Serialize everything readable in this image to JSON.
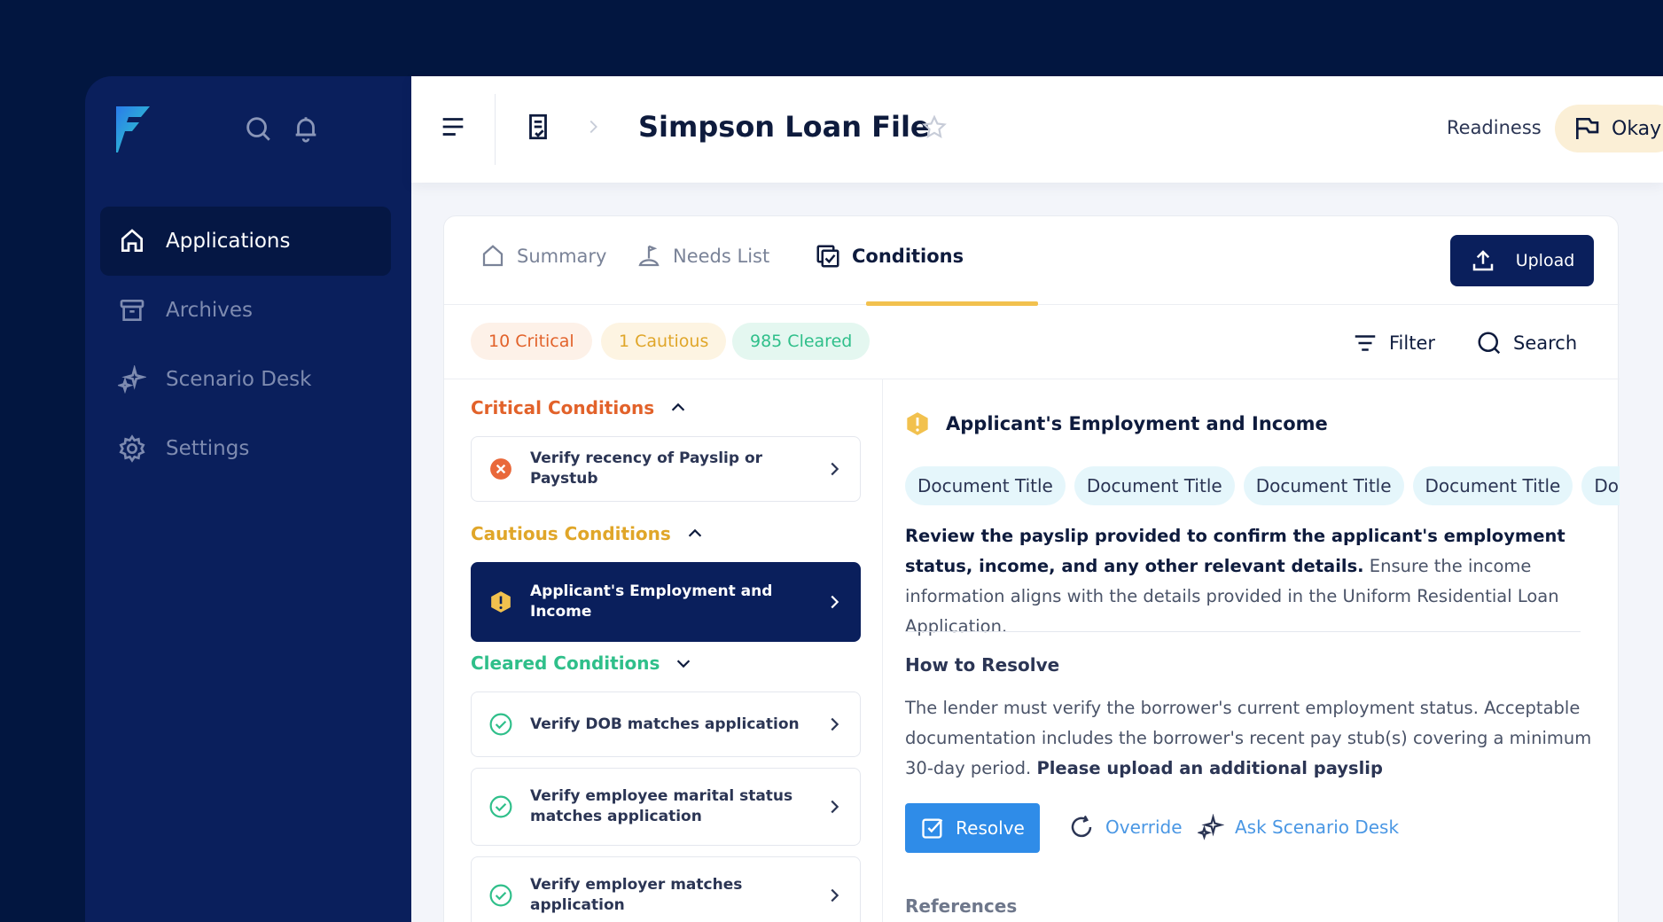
{
  "sidebar": {
    "logo": "brand-logo",
    "items": [
      {
        "label": "Applications",
        "icon": "home-icon",
        "active": true
      },
      {
        "label": "Archives",
        "icon": "archive-icon",
        "active": false
      },
      {
        "label": "Scenario Desk",
        "icon": "sparkle-icon",
        "active": false
      },
      {
        "label": "Settings",
        "icon": "gear-icon",
        "active": false
      }
    ]
  },
  "topbar": {
    "title": "Simpson Loan File",
    "readiness_label": "Readiness",
    "readiness_status": "Okay"
  },
  "tabs": [
    {
      "label": "Summary",
      "icon": "house-outline-icon",
      "active": false
    },
    {
      "label": "Needs List",
      "icon": "needs-list-icon",
      "active": false
    },
    {
      "label": "Conditions",
      "icon": "conditions-icon",
      "active": true
    }
  ],
  "upload_label": "Upload",
  "counts": {
    "critical": "10 Critical",
    "cautious": "1 Cautious",
    "cleared": "985 Cleared"
  },
  "tools": {
    "filter": "Filter",
    "search": "Search"
  },
  "sections": {
    "critical": {
      "title": "Critical Conditions",
      "items": [
        "Verify recency of Payslip or Paystub"
      ]
    },
    "cautious": {
      "title": "Cautious Conditions",
      "items": [
        "Applicant's Employment and Income"
      ]
    },
    "cleared": {
      "title": "Cleared Conditions",
      "items": [
        "Verify DOB matches application",
        "Verify employee marital status matches application",
        "Verify employer matches application"
      ]
    }
  },
  "detail": {
    "title": "Applicant's Employment and Income",
    "documents": [
      "Document Title",
      "Document Title",
      "Document Title",
      "Document Title",
      "Doc"
    ],
    "description_bold": "Review the payslip provided to confirm the applicant's employment status, income, and any other relevant details.",
    "description_rest": " Ensure the income information aligns with the details provided in the Uniform Residential Loan Application.",
    "how_to_resolve_title": "How to Resolve",
    "how_to_resolve_text": "The lender must verify the borrower's current employment status. Acceptable documentation includes the borrower's recent pay stub(s) covering a minimum 30-day period. ",
    "how_to_resolve_bold": "Please upload an additional payslip",
    "actions": {
      "resolve": "Resolve",
      "override": "Override",
      "ask": "Ask Scenario Desk"
    },
    "references_title": "References"
  },
  "colors": {
    "background": "#021640",
    "sidebar": "#0a1f5c",
    "critical": "#e2622a",
    "cautious": "#e0a629",
    "cleared": "#2fbf8a",
    "accent_blue": "#2f8ce8",
    "tab_underline": "#f2c14e"
  }
}
